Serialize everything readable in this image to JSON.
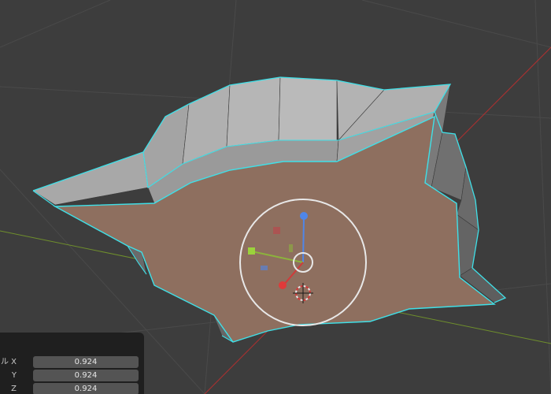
{
  "scale_panel": {
    "x_label": "ール X",
    "y_label": "Y",
    "z_label": "Z",
    "x_value": "0.924",
    "y_value": "0.924",
    "z_value": "0.924"
  },
  "colors": {
    "viewport_bg": "#3d3d3d",
    "selected_face": "#8e6f5f",
    "unselected_face": "#9c9c9c",
    "selected_edge": "#3fe0e8",
    "x_axis": "#d03a3a",
    "y_axis": "#8cb33c",
    "z_axis": "#4f86e8"
  },
  "icons": {
    "gizmo": "transform-gizmo-icon",
    "cursor": "3d-cursor-icon"
  }
}
